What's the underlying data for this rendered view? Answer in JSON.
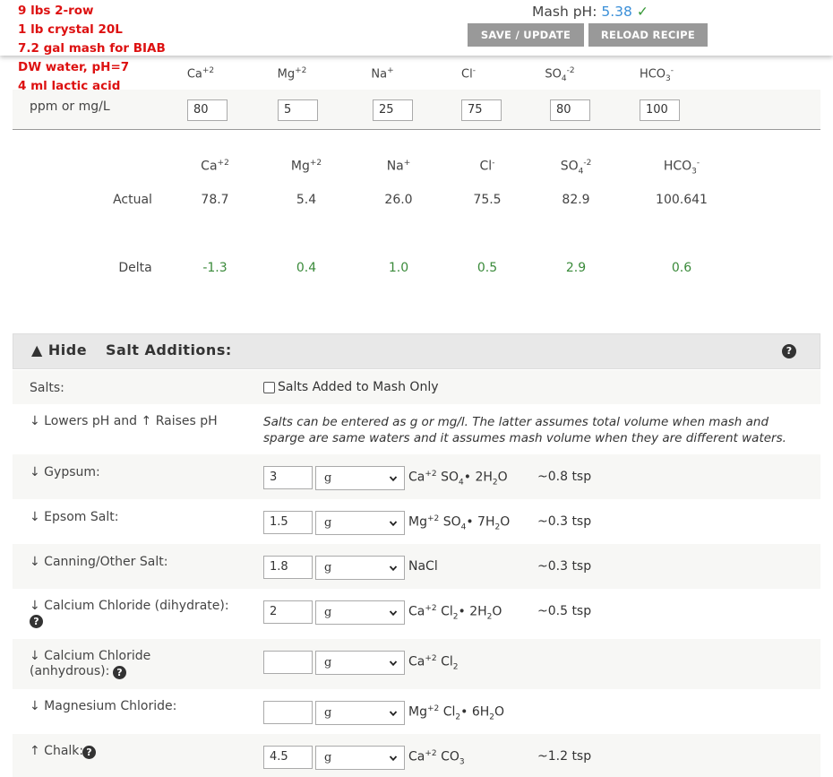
{
  "notes": [
    "9 lbs 2-row",
    "1 lb crystal 20L",
    "7.2 gal mash for BIAB",
    "DW water, pH=7",
    "4 ml lactic acid"
  ],
  "header": {
    "mash_ph_label": "Mash pH:",
    "mash_ph_value": "5.38",
    "check": "✓",
    "save_label": "SAVE / UPDATE",
    "reload_label": "RELOAD RECIPE"
  },
  "ions": [
    {
      "base": "Ca",
      "sup": "+2",
      "sub": ""
    },
    {
      "base": "Mg",
      "sup": "+2",
      "sub": ""
    },
    {
      "base": "Na",
      "sup": "+",
      "sub": ""
    },
    {
      "base": "Cl",
      "sup": "-",
      "sub": ""
    },
    {
      "base": "SO",
      "sub": "4",
      "sup": "-2"
    },
    {
      "base": "HCO",
      "sub": "3",
      "sup": "-"
    }
  ],
  "target": {
    "label": "ppm or mg/L",
    "values": [
      "80",
      "5",
      "25",
      "75",
      "80",
      "100"
    ]
  },
  "results": {
    "actual_label": "Actual",
    "actual": [
      "78.7",
      "5.4",
      "26.0",
      "75.5",
      "82.9",
      "100.641"
    ],
    "delta_label": "Delta",
    "delta": [
      "-1.3",
      "0.4",
      "1.0",
      "0.5",
      "2.9",
      "0.6"
    ]
  },
  "salts_section": {
    "hide_label": "▲ Hide",
    "title": "Salt Additions:",
    "salts_label": "Salts:",
    "mash_only_label": "Salts Added to Mash Only",
    "legend": "↓ Lowers pH and ↑ Raises pH",
    "note": "Salts can be entered as g or mg/l. The latter assumes total volume when mash and sparge are same waters and it assumes mash volume when they are different waters.",
    "items": [
      {
        "label": "↓ Gypsum:",
        "value": "3",
        "unit": "g",
        "formula": [
          "Ca",
          "+2",
          " SO",
          "4",
          "• 2H",
          "2",
          "O"
        ],
        "tsp": "~0.8 tsp"
      },
      {
        "label": "↓ Epsom Salt:",
        "value": "1.5",
        "unit": "g",
        "formula": [
          "Mg",
          "+2",
          " SO",
          "4",
          "• 7H",
          "2",
          "O"
        ],
        "tsp": "~0.3 tsp"
      },
      {
        "label": "↓ Canning/Other Salt:",
        "value": "1.8",
        "unit": "g",
        "formula": [
          "NaCl"
        ],
        "tsp": "~0.3 tsp"
      },
      {
        "label": "↓ Calcium Chloride (dihydrate):",
        "value": "2",
        "unit": "g",
        "formula": [
          "Ca",
          "+2",
          " Cl",
          "2",
          "• 2H",
          "2",
          "O"
        ],
        "tsp": "~0.5 tsp"
      },
      {
        "label_line1": "↓ Calcium Chloride",
        "label_line2": "(anhydrous):",
        "value": "",
        "unit": "g",
        "formula": [
          "Ca",
          "+2",
          " Cl",
          "2"
        ],
        "tsp": ""
      },
      {
        "label": "↓ Magnesium Chloride:",
        "value": "",
        "unit": "g",
        "formula": [
          "Mg",
          "+2",
          " Cl",
          "2",
          "• 6H",
          "2",
          "O"
        ],
        "tsp": ""
      },
      {
        "label": "↑ Chalk:",
        "value": "4.5",
        "unit": "g",
        "formula": [
          "Ca",
          "+2",
          " CO",
          "3"
        ],
        "tsp": "~1.2 tsp"
      }
    ]
  }
}
